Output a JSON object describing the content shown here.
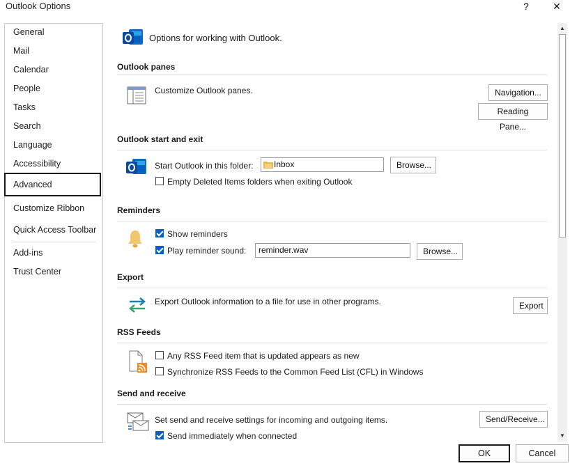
{
  "window": {
    "title": "Outlook Options",
    "help": "?",
    "close": "✕"
  },
  "sidebar": {
    "items": [
      {
        "label": "General"
      },
      {
        "label": "Mail"
      },
      {
        "label": "Calendar"
      },
      {
        "label": "People"
      },
      {
        "label": "Tasks"
      },
      {
        "label": "Search"
      },
      {
        "label": "Language"
      },
      {
        "label": "Accessibility"
      },
      {
        "label": "Advanced"
      },
      {
        "label": "Customize Ribbon"
      },
      {
        "label": "Quick Access Toolbar"
      },
      {
        "label": "Add-ins"
      },
      {
        "label": "Trust Center"
      }
    ],
    "selected": "Advanced"
  },
  "header": {
    "text": "Options for working with Outlook."
  },
  "panes": {
    "title": "Outlook panes",
    "desc": "Customize Outlook panes.",
    "navigation_button": "Navigation...",
    "reading_pane_button": "Reading Pane..."
  },
  "start_exit": {
    "title": "Outlook start and exit",
    "start_label": "Start Outlook in this folder:",
    "folder_value": "Inbox",
    "browse_button": "Browse...",
    "empty_deleted_label": "Empty Deleted Items folders when exiting Outlook",
    "empty_deleted_checked": false
  },
  "reminders": {
    "title": "Reminders",
    "show_label": "Show reminders",
    "show_checked": true,
    "play_label": "Play reminder sound:",
    "play_checked": true,
    "sound_value": "reminder.wav",
    "browse_button": "Browse..."
  },
  "export": {
    "title": "Export",
    "desc": "Export Outlook information to a file for use in other programs.",
    "button": "Export"
  },
  "rss": {
    "title": "RSS Feeds",
    "item_label": "Any RSS Feed item that is updated appears as new",
    "item_checked": false,
    "sync_label": "Synchronize RSS Feeds to the Common Feed List (CFL) in Windows",
    "sync_checked": false
  },
  "send_receive": {
    "title": "Send and receive",
    "desc": "Set send and receive settings for incoming and outgoing items.",
    "button": "Send/Receive...",
    "immediate_label": "Send immediately when connected",
    "immediate_checked": true
  },
  "footer": {
    "ok": "OK",
    "cancel": "Cancel"
  },
  "colors": {
    "accent": "#0a5fc4",
    "outlook_blue": "#0f6cbd",
    "bell": "#f2c66d"
  },
  "icons": {
    "outlook_logo": "outlook-logo-icon",
    "panes": "panes-icon",
    "bell": "bell-icon",
    "export": "export-arrows-icon",
    "rss": "rss-icon",
    "send_receive": "send-receive-icon",
    "folder": "folder-icon"
  }
}
